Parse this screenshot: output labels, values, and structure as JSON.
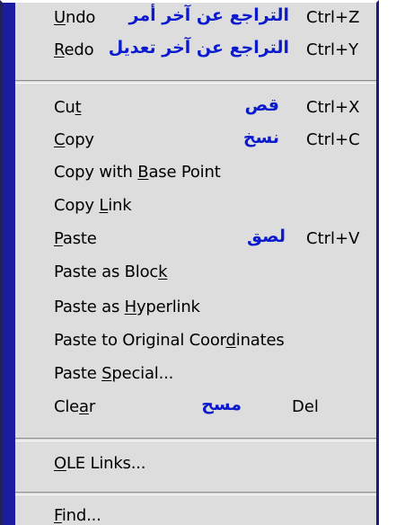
{
  "menu": {
    "items": [
      {
        "pre": "",
        "u": "U",
        "post": "ndo",
        "arabic": "التراجع عن آخر أمر",
        "shortcut": "Ctrl+Z"
      },
      {
        "pre": "",
        "u": "R",
        "post": "edo",
        "arabic": "التراجع عن آخر تعديل",
        "shortcut": "Ctrl+Y"
      },
      {
        "pre": "Cu",
        "u": "t",
        "post": "",
        "arabic": "قص",
        "shortcut": "Ctrl+X"
      },
      {
        "pre": "",
        "u": "C",
        "post": "opy",
        "arabic": "نسخ",
        "shortcut": "Ctrl+C"
      },
      {
        "pre": "Copy with ",
        "u": "B",
        "post": "ase Point"
      },
      {
        "pre": "Copy ",
        "u": "L",
        "post": "ink"
      },
      {
        "pre": "",
        "u": "P",
        "post": "aste",
        "arabic": "لصق",
        "shortcut": "Ctrl+V"
      },
      {
        "pre": "Paste as Bloc",
        "u": "k",
        "post": ""
      },
      {
        "pre": "Paste as ",
        "u": "H",
        "post": "yperlink"
      },
      {
        "pre": "Paste to Original Coor",
        "u": "d",
        "post": "inates"
      },
      {
        "pre": "Paste ",
        "u": "S",
        "post": "pecial..."
      },
      {
        "pre": "Cle",
        "u": "a",
        "post": "r",
        "arabic": "مسح",
        "shortcut": "Del"
      },
      {
        "pre": "",
        "u": "O",
        "post": "LE Links..."
      },
      {
        "pre": "",
        "u": "F",
        "post": "ind..."
      }
    ]
  },
  "colors": {
    "menu_background": "#dddddd",
    "side_bar": "#1c1ca0",
    "arabic_text": "#0a1acc"
  }
}
